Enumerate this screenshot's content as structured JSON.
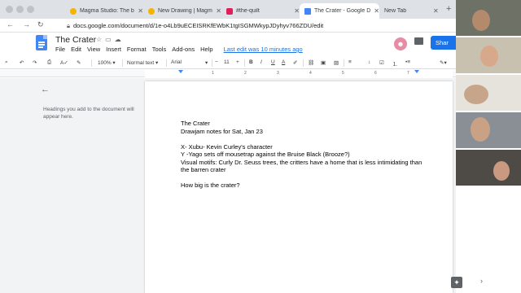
{
  "browser": {
    "tabs": [
      {
        "label": "Magma Studio: The bro",
        "active": false,
        "favicon_color": "#f4b400"
      },
      {
        "label": "New Drawing | Magma S",
        "active": false,
        "favicon_color": "#f4b400"
      },
      {
        "label": "#the-quilt",
        "active": false,
        "favicon_color": "#e01e5a"
      },
      {
        "label": "The Crater - Google Do",
        "active": true,
        "favicon_color": "#4285f4"
      },
      {
        "label": "New Tab",
        "active": false,
        "favicon_color": ""
      }
    ],
    "new_tab_symbol": "+",
    "url": "docs.google.com/document/d/1e-o4Lb9uECEISRKfEWbK1tgISGMWkypJDyhyv766ZDU/edit"
  },
  "docs": {
    "title": "The Crater",
    "menu": [
      "File",
      "Edit",
      "View",
      "Insert",
      "Format",
      "Tools",
      "Add-ons",
      "Help"
    ],
    "last_edit": "Last edit was 10 minutes ago",
    "share_label": "Shar",
    "avatar_icon": "anonymous-animal-icon",
    "toolbar": {
      "zoom": "100%",
      "style": "Normal text",
      "font": "Arial",
      "font_size": "11",
      "bold": "B",
      "italic": "I",
      "underline": "U",
      "text_color": "A"
    },
    "ruler_numbers": [
      "1",
      "2",
      "3",
      "4",
      "5",
      "6",
      "7"
    ],
    "outline_hint": "Headings you add to the document will appear here.",
    "body": [
      "The Crater",
      "Drawjam notes for Sat, Jan 23",
      "",
      "X- Xubu- Kevin Curley's character",
      "Y -Yago sets off mousetrap against the Bruise Black (Brooze?)",
      "Visual motifs: Curly Dr. Seuss trees, the critters have a home that is less intimidating than the barren crater",
      "",
      "How big is the crater?"
    ]
  },
  "colors": {
    "accent": "#1a73e8",
    "docs_blue": "#4285f4",
    "tabstrip": "#dee1e6",
    "workspace": "#f1f3f4"
  }
}
